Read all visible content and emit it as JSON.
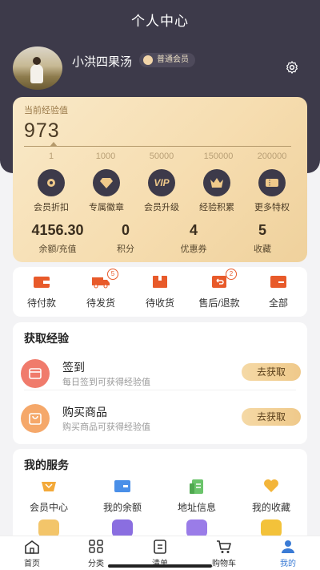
{
  "header": {
    "title": "个人中心"
  },
  "profile": {
    "username": "小洪四果汤",
    "member_level": "普通会员",
    "settings_icon": "gear-icon"
  },
  "experience": {
    "label": "当前经验值",
    "value": "973",
    "levels": [
      "1",
      "1000",
      "50000",
      "150000",
      "200000"
    ],
    "perks": [
      {
        "label": "会员折扣",
        "icon": "discount-icon"
      },
      {
        "label": "专属徽章",
        "icon": "diamond-icon"
      },
      {
        "label": "会员升级",
        "icon": "vip-icon"
      },
      {
        "label": "经验积累",
        "icon": "crown-icon"
      },
      {
        "label": "更多特权",
        "icon": "ticket-icon"
      }
    ],
    "stats": [
      {
        "value": "4156.30",
        "label": "余额/充值"
      },
      {
        "value": "0",
        "label": "积分"
      },
      {
        "value": "4",
        "label": "优惠券"
      },
      {
        "value": "5",
        "label": "收藏"
      }
    ]
  },
  "orders": {
    "items": [
      {
        "label": "待付款",
        "icon": "wallet-icon",
        "badge": ""
      },
      {
        "label": "待发货",
        "icon": "truck-icon",
        "badge": "5"
      },
      {
        "label": "待收货",
        "icon": "package-icon",
        "badge": ""
      },
      {
        "label": "售后/退款",
        "icon": "refund-icon",
        "badge": "2"
      },
      {
        "label": "全部",
        "icon": "orders-icon",
        "badge": ""
      }
    ]
  },
  "earn": {
    "title": "获取经验",
    "tasks": [
      {
        "name": "签到",
        "desc": "每日签到可获得经验值",
        "action": "去获取",
        "icon": "calendar-icon",
        "color": "#f07b6c"
      },
      {
        "name": "购买商品",
        "desc": "购买商品可获得经验值",
        "action": "去获取",
        "icon": "bag-icon",
        "color": "#f5a86a"
      }
    ]
  },
  "services": {
    "title": "我的服务",
    "items": [
      {
        "label": "会员中心",
        "icon": "member-card-icon",
        "color": "#f3a93a"
      },
      {
        "label": "我的余额",
        "icon": "balance-card-icon",
        "color": "#4a8fe8"
      },
      {
        "label": "地址信息",
        "icon": "address-icon",
        "color": "#6bc46b"
      },
      {
        "label": "我的收藏",
        "icon": "heart-icon",
        "color": "#f3b53a"
      }
    ]
  },
  "tabbar": {
    "items": [
      {
        "label": "首页",
        "icon": "home-icon"
      },
      {
        "label": "分类",
        "icon": "grid-icon"
      },
      {
        "label": "清单",
        "icon": "list-icon"
      },
      {
        "label": "购物车",
        "icon": "cart-icon"
      },
      {
        "label": "我的",
        "icon": "user-icon"
      }
    ],
    "active_color": "#3a7bd5"
  },
  "colors": {
    "header_bg": "#3d3a4a",
    "accent_orange": "#e85a2a",
    "gold": "#efc98a"
  }
}
